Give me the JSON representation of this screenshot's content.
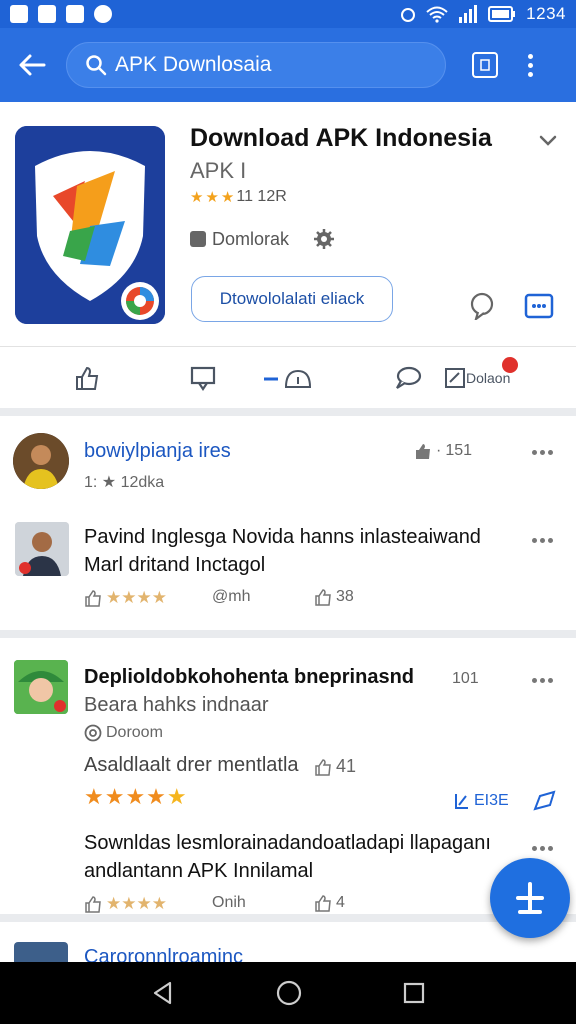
{
  "status_bar": {
    "time": "1234"
  },
  "search": {
    "value": "APK Downlosaia"
  },
  "app": {
    "title": "Download APK Indonesia",
    "subtitle": "APK I",
    "rating_text": "11 12R",
    "rating_stars": 3,
    "download_label": "Domlorak",
    "download_button": "Dtowololalati eliack"
  },
  "action_row": {
    "item5_label": "Dolaon"
  },
  "comments": [
    {
      "name": "bowiylpianja ires",
      "meta": "1: ★ 12dka",
      "likes": "151"
    },
    {
      "line1": "Pavind Inglesga Novida hanns inlasteaiwand",
      "line2": "Marl dritand Inctagol",
      "time": "@mh",
      "likes": "38"
    }
  ],
  "review": {
    "title": "Deplioldobkohohenta bneprinasnd",
    "count": "101",
    "subtitle": "Beara hahks indnaar",
    "source": "Doroom",
    "body": "Asaldlaalt drer mentlatla",
    "likes": "41",
    "stars": 5,
    "badge": "EI3E",
    "line1": "Sownldas lesmlorainadandoatladapi llapaganı",
    "line2": "andlantann APK Innilamal",
    "time": "Onih",
    "likes2": "4"
  },
  "next_item": {
    "name": "Caroronnlroaminc"
  },
  "colors": {
    "primary": "#2a6fe0",
    "star": "#f3a21d",
    "link": "#1c57c1"
  }
}
